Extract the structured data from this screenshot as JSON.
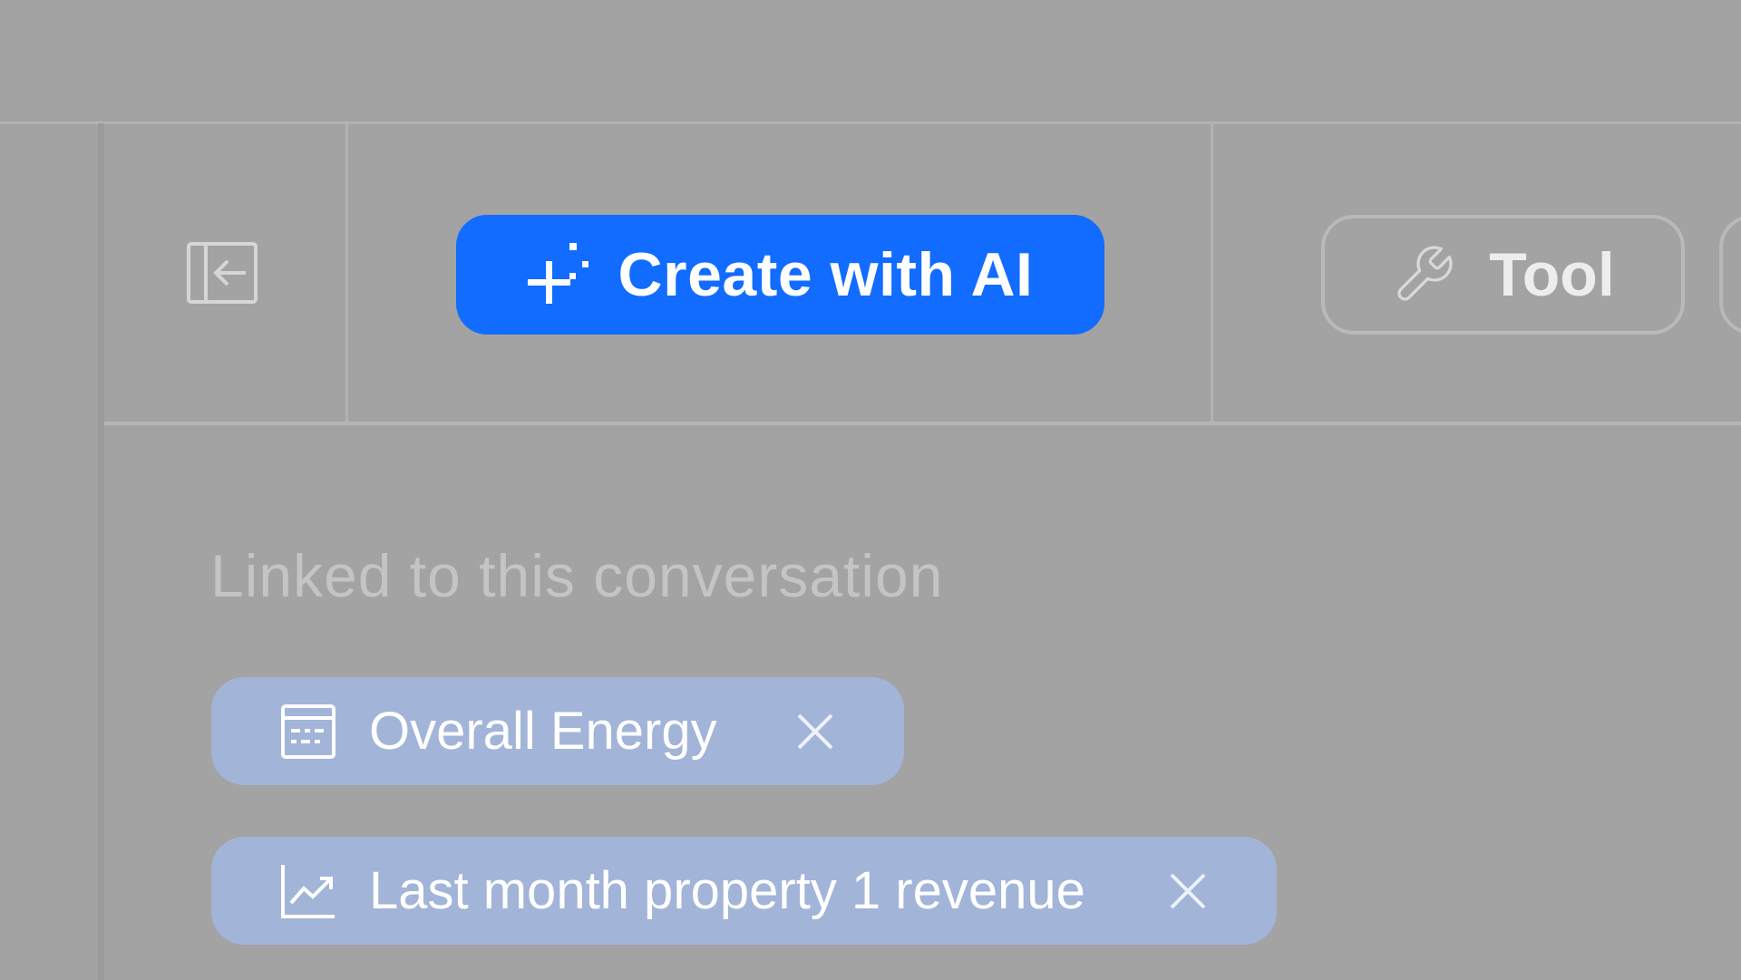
{
  "toolbar": {
    "collapse_icon": "panel-collapse-icon",
    "create_ai_label": "Create with AI",
    "create_ai_icon": "sparkle-plus-icon",
    "tool_label": "Tool",
    "tool_icon": "wrench-icon"
  },
  "linked": {
    "title": "Linked to this conversation",
    "items": [
      {
        "label": "Overall Energy",
        "icon": "table-calendar-icon"
      },
      {
        "label": "Last month property 1 revenue",
        "icon": "line-chart-icon"
      }
    ]
  },
  "colors": {
    "background": "#a3a3a3",
    "accent": "#116cff",
    "chip_bg": "#a2b4d8"
  }
}
